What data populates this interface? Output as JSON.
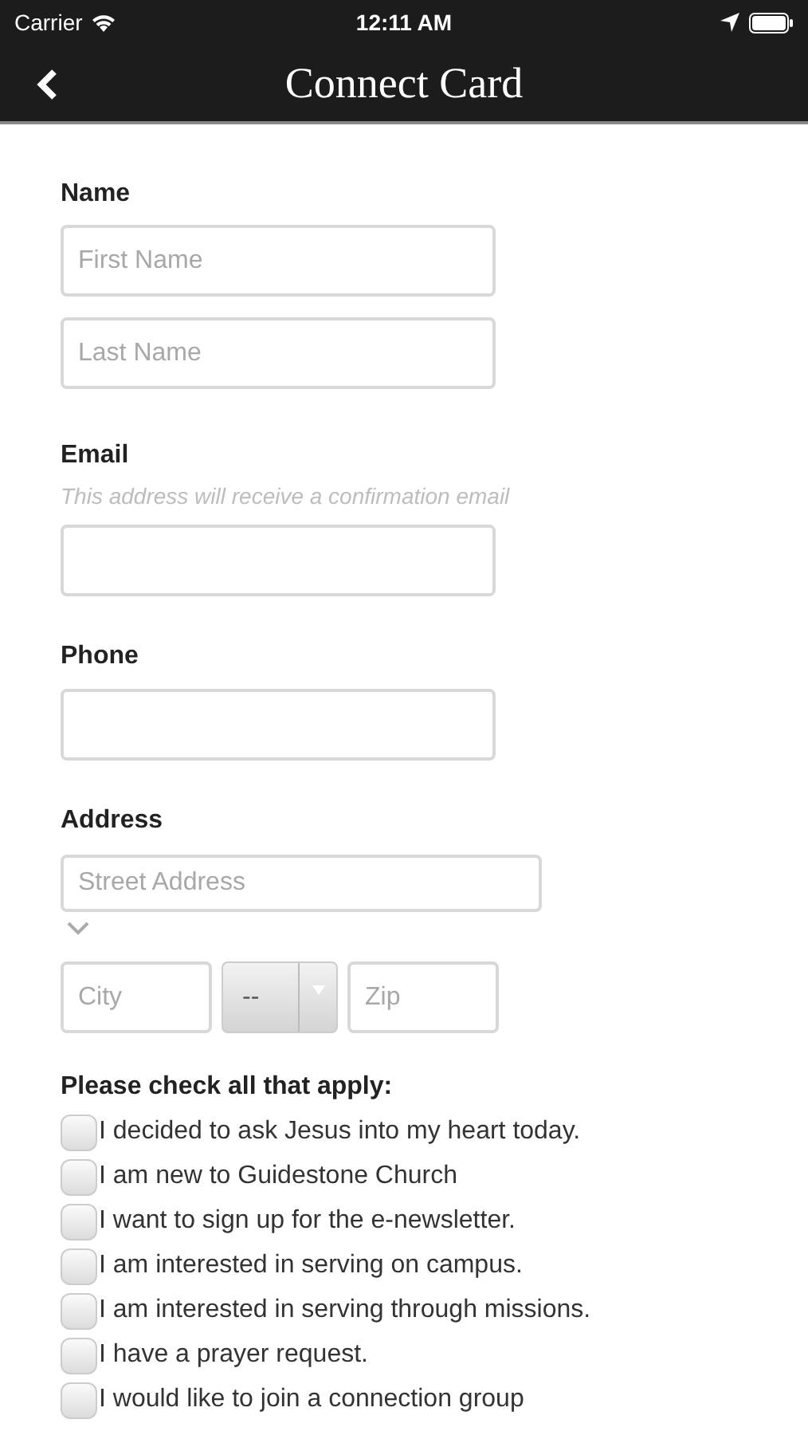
{
  "status_bar": {
    "carrier": "Carrier",
    "time": "12:11 AM"
  },
  "nav": {
    "title": "Connect Card"
  },
  "name": {
    "label": "Name",
    "fields": [
      {
        "placeholder": "First Name"
      },
      {
        "placeholder": "Last Name"
      }
    ]
  },
  "email": {
    "label": "Email",
    "hint": "This address will receive a confirmation email"
  },
  "phone": {
    "label": "Phone"
  },
  "address": {
    "label": "Address",
    "street": {
      "placeholder": "Street Address"
    },
    "city": {
      "placeholder": "City"
    },
    "state": {
      "value": "--"
    },
    "zip": {
      "placeholder": "Zip"
    }
  },
  "checklist": {
    "title": "Please check all that apply:",
    "items": [
      {
        "label": "I decided to ask Jesus into my heart today.",
        "checked": false
      },
      {
        "label": "I am new to Guidestone Church",
        "checked": false
      },
      {
        "label": "I want to sign up for the e-newsletter.",
        "checked": false
      },
      {
        "label": "I am interested in serving on campus.",
        "checked": false
      },
      {
        "label": "I am interested in serving through missions.",
        "checked": false
      },
      {
        "label": "I have a prayer request.",
        "checked": false
      },
      {
        "label": "I would like to join a connection group",
        "checked": false
      }
    ]
  }
}
